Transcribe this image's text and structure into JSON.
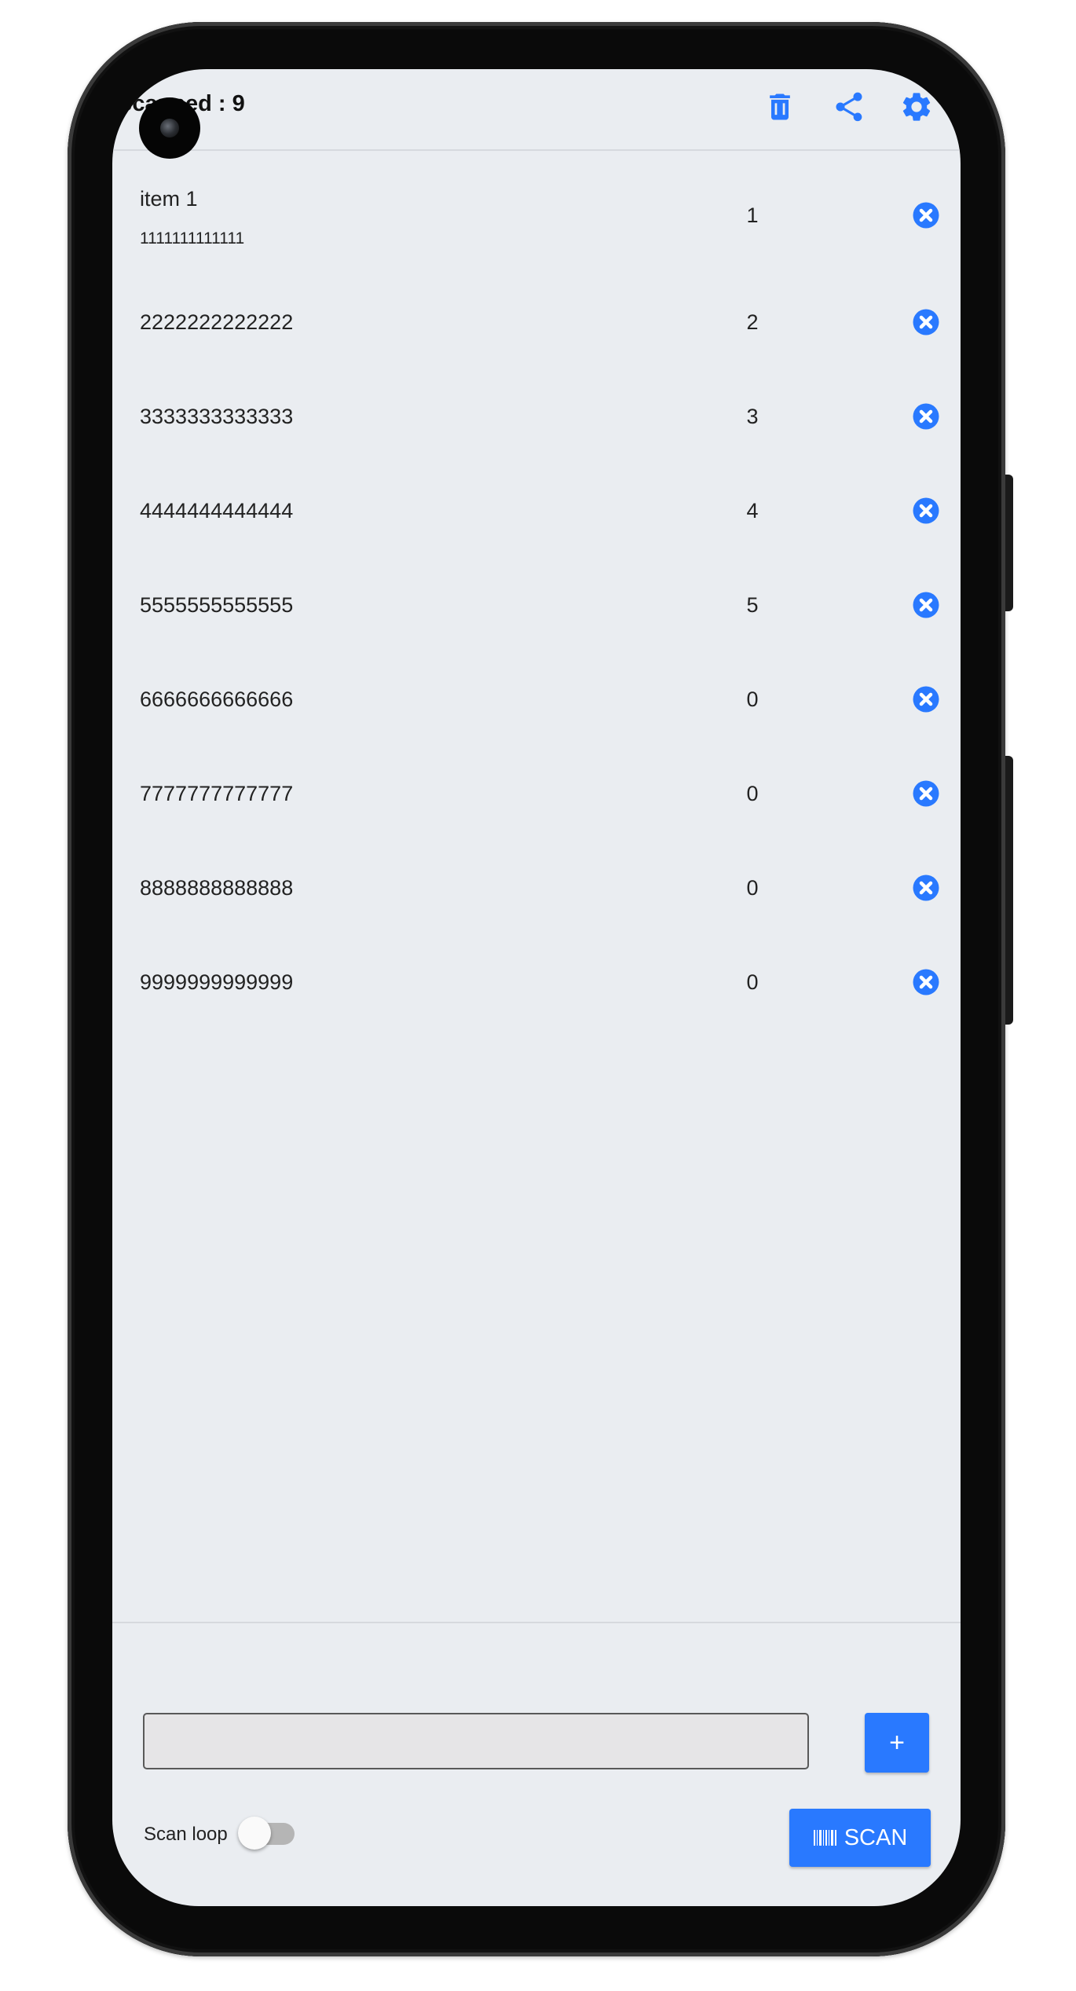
{
  "header": {
    "title": "Scanned : 9",
    "icons": [
      "trash-icon",
      "share-icon",
      "gear-icon"
    ]
  },
  "items": [
    {
      "name": "item 1",
      "code": "1111111111111",
      "qty": "1"
    },
    {
      "code": "2222222222222",
      "qty": "2"
    },
    {
      "code": "3333333333333",
      "qty": "3"
    },
    {
      "code": "4444444444444",
      "qty": "4"
    },
    {
      "code": "5555555555555",
      "qty": "5"
    },
    {
      "code": "6666666666666",
      "qty": "0"
    },
    {
      "code": "7777777777777",
      "qty": "0"
    },
    {
      "code": "8888888888888",
      "qty": "0"
    },
    {
      "code": "9999999999999",
      "qty": "0"
    }
  ],
  "footer": {
    "input_value": "",
    "add_label": "+",
    "scan_loop_label": "Scan loop",
    "scan_loop_on": false,
    "scan_label": "SCAN"
  },
  "colors": {
    "accent": "#2979ff",
    "background": "#eaedf1"
  }
}
